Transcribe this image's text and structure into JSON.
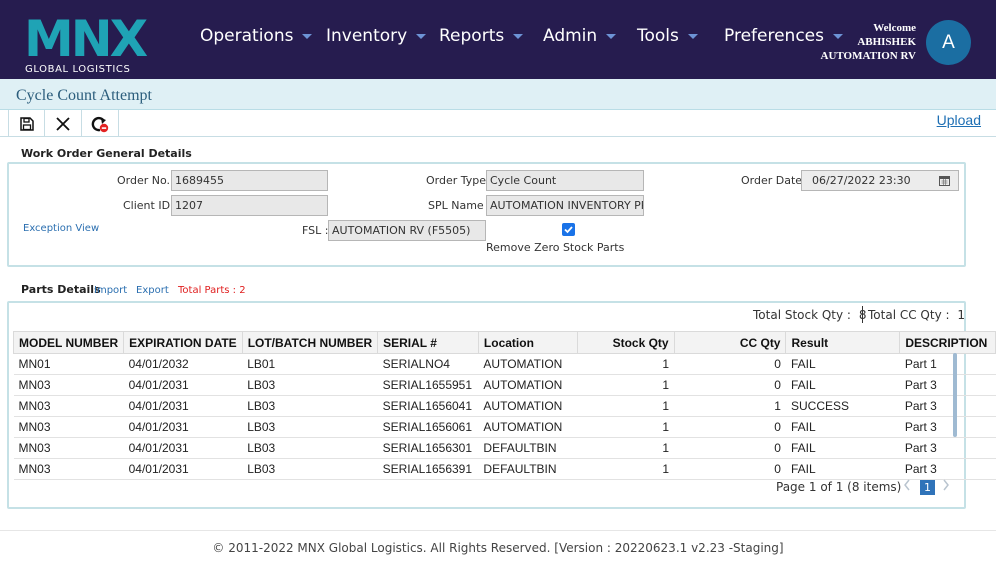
{
  "brand": {
    "logo_text": "MNX",
    "logo_sub": "GLOBAL LOGISTICS"
  },
  "nav": {
    "items": [
      {
        "label": "Operations"
      },
      {
        "label": "Inventory"
      },
      {
        "label": "Reports"
      },
      {
        "label": "Admin"
      },
      {
        "label": "Tools"
      },
      {
        "label": "Preferences"
      }
    ],
    "welcome": "Welcome",
    "user_name": "ABHISHEK",
    "user_org": "AUTOMATION RV",
    "avatar_letter": "A"
  },
  "page": {
    "title": "Cycle Count Attempt"
  },
  "toolbar": {
    "icons": [
      "save-icon",
      "close-icon",
      "refresh-icon"
    ],
    "upload_label": "Upload"
  },
  "work_order": {
    "section_title": "Work Order General Details",
    "order_no_label": "Order No. :",
    "order_no": "1689455",
    "client_id_label": "Client ID :",
    "client_id": "1207",
    "order_type_label": "Order Type :",
    "order_type": "Cycle Count",
    "spl_name_label": "SPL Name :",
    "spl_name": "AUTOMATION INVENTORY PRO",
    "fsl_label": "FSL :",
    "fsl": "AUTOMATION RV (F5505)",
    "order_date_label": "Order Date :",
    "order_date": "06/27/2022 23:30",
    "exception_view": "Exception View",
    "remove_zero_label": "Remove Zero Stock Parts",
    "remove_zero_checked": true
  },
  "parts": {
    "section_title": "Parts Details",
    "import_label": "Import",
    "export_label": "Export",
    "total_parts": "Total Parts : 2",
    "total_stock_label": "Total Stock Qty :",
    "total_stock_value": "8",
    "total_cc_label": "Total CC Qty :",
    "total_cc_value": "1",
    "columns": [
      "MODEL NUMBER",
      "EXPIRATION DATE",
      "LOT/BATCH NUMBER",
      "SERIAL #",
      "Location",
      "Stock Qty",
      "CC Qty",
      "Result",
      "DESCRIPTION"
    ],
    "rows": [
      [
        "MN01",
        "04/01/2032",
        "LB01",
        "SERIALNO4",
        "AUTOMATION",
        "1",
        "0",
        "FAIL",
        "Part 1"
      ],
      [
        "MN03",
        "04/01/2031",
        "LB03",
        "SERIAL1655951",
        "AUTOMATION",
        "1",
        "0",
        "FAIL",
        "Part 3"
      ],
      [
        "MN03",
        "04/01/2031",
        "LB03",
        "SERIAL1656041",
        "AUTOMATION",
        "1",
        "1",
        "SUCCESS",
        "Part 3"
      ],
      [
        "MN03",
        "04/01/2031",
        "LB03",
        "SERIAL1656061",
        "AUTOMATION",
        "1",
        "0",
        "FAIL",
        "Part 3"
      ],
      [
        "MN03",
        "04/01/2031",
        "LB03",
        "SERIAL1656301",
        "DEFAULTBIN",
        "1",
        "0",
        "FAIL",
        "Part 3"
      ],
      [
        "MN03",
        "04/01/2031",
        "LB03",
        "SERIAL1656391",
        "DEFAULTBIN",
        "1",
        "0",
        "FAIL",
        "Part 3"
      ]
    ],
    "pager_text": "Page 1 of 1 (8 items)",
    "current_page": "1",
    "colors": {
      "fail": "#e53935",
      "success": "#2e9c3a"
    }
  },
  "footer": {
    "text": "© 2011-2022 MNX Global Logistics. All Rights Reserved. [Version : 20220623.1 v2.23 -Staging]"
  },
  "colors": {
    "nav_bg": "#261c4f",
    "logo_teal": "#1fa3b5",
    "accent_blue": "#2f73b9",
    "title_bar_bg": "#dff0f5"
  }
}
